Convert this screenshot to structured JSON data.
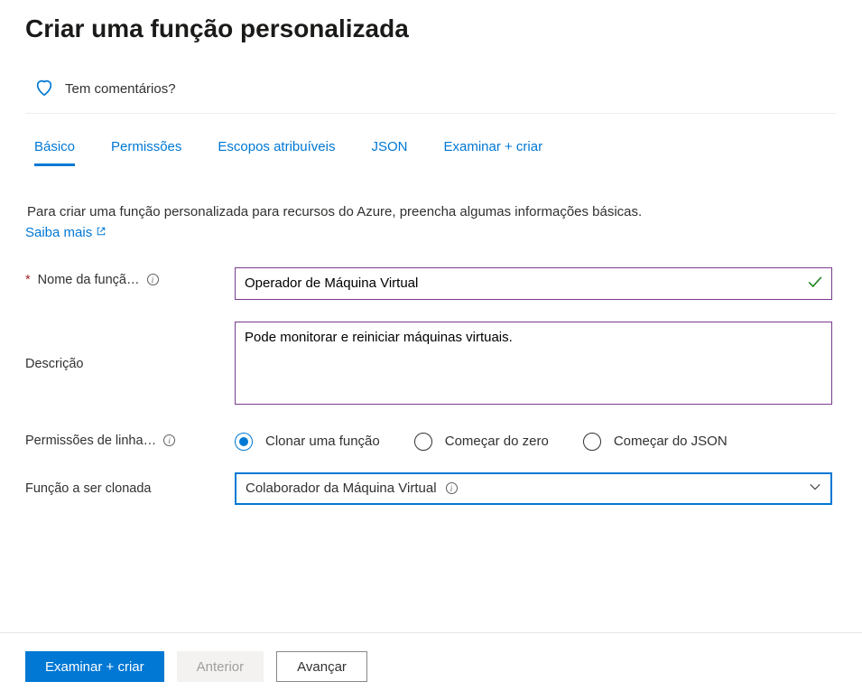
{
  "header": {
    "title": "Criar uma função personalizada",
    "feedback": "Tem comentários?"
  },
  "tabs": {
    "basic": "Básico",
    "permissions": "Permissões",
    "scopes": "Escopos atribuíveis",
    "json": "JSON",
    "review": "Examinar + criar"
  },
  "intro": {
    "text": "Para criar uma função personalizada para recursos do Azure, preencha algumas informações básicas.",
    "learn_more": "Saiba mais"
  },
  "form": {
    "role_name_label": "Nome da funçã…",
    "role_name_value": "Operador de Máquina Virtual",
    "description_label": "Descrição",
    "description_value": "Pode monitorar e reiniciar máquinas virtuais.",
    "baseline_label": "Permissões de linha…",
    "radio": {
      "clone": "Clonar uma função",
      "scratch": "Começar do zero",
      "json": "Começar do JSON"
    },
    "role_to_clone_label": "Função a ser clonada",
    "role_to_clone_value": "Colaborador da Máquina Virtual"
  },
  "footer": {
    "review_create": "Examinar + criar",
    "previous": "Anterior",
    "next": "Avançar"
  }
}
